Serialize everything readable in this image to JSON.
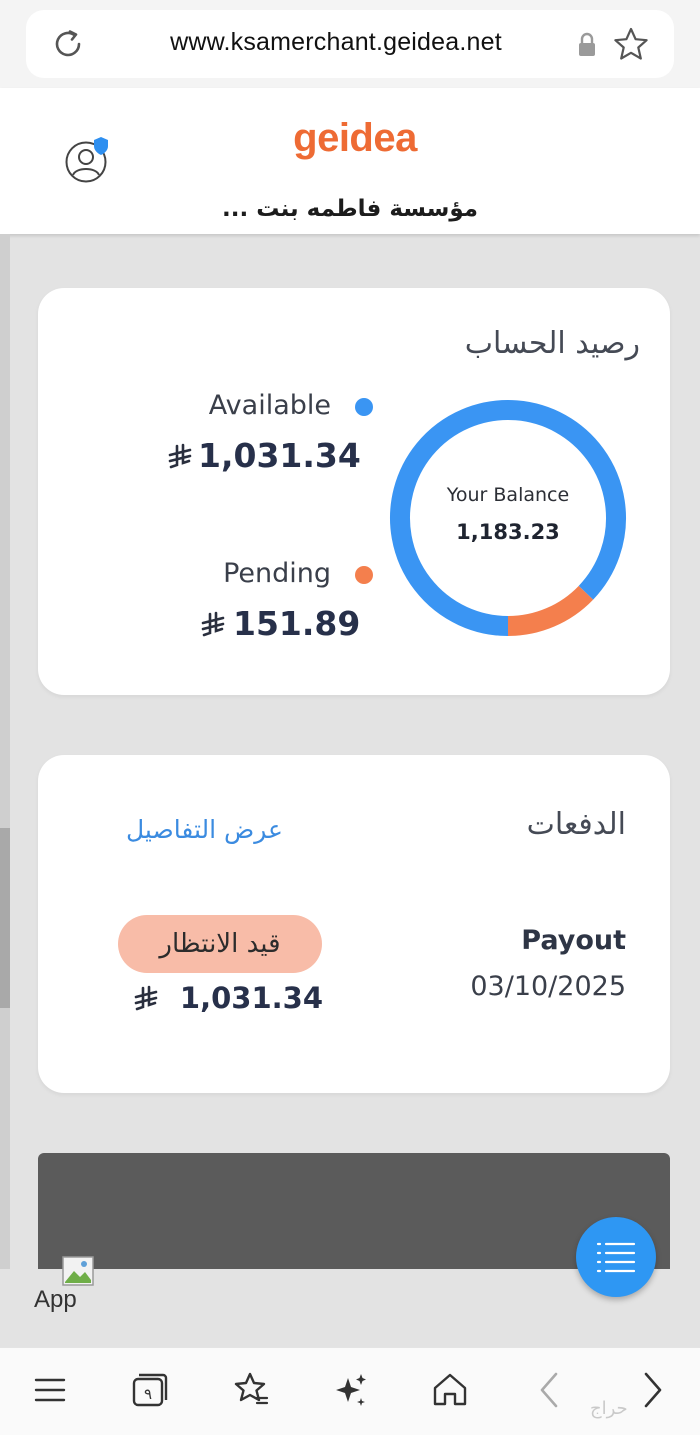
{
  "browser": {
    "url": "www.ksamerchant.geidea.net"
  },
  "header": {
    "logo_text": "geidea",
    "merchant_name": "مؤسسة فاطمه بنت ..."
  },
  "balance_card": {
    "title": "رصيد الحساب",
    "available_label": "Available",
    "available_amount": "1,031.34",
    "pending_label": "Pending",
    "pending_amount": "151.89",
    "center_label": "Your Balance",
    "center_value": "1,183.23",
    "colors": {
      "available": "#3a95f3",
      "pending": "#f47f4d"
    }
  },
  "chart_data": {
    "type": "pie",
    "categories": [
      "Available",
      "Pending"
    ],
    "values": [
      1031.34,
      151.89
    ]
  },
  "payouts_card": {
    "title": "الدفعات",
    "details_link": "عرض التفاصيل",
    "payout_label": "Payout",
    "payout_date": "03/10/2025",
    "status": "قيد الانتظار",
    "amount": "1,031.34"
  },
  "broken_image": {
    "alt_text": "App"
  },
  "bottom_nav": {
    "items": [
      "menu-icon",
      "tabs-icon",
      "bookmarks-icon",
      "ai-sparkle-icon",
      "home-icon",
      "back-icon",
      "forward-icon"
    ],
    "tabs_count": "٩"
  },
  "watermark": "حراج"
}
